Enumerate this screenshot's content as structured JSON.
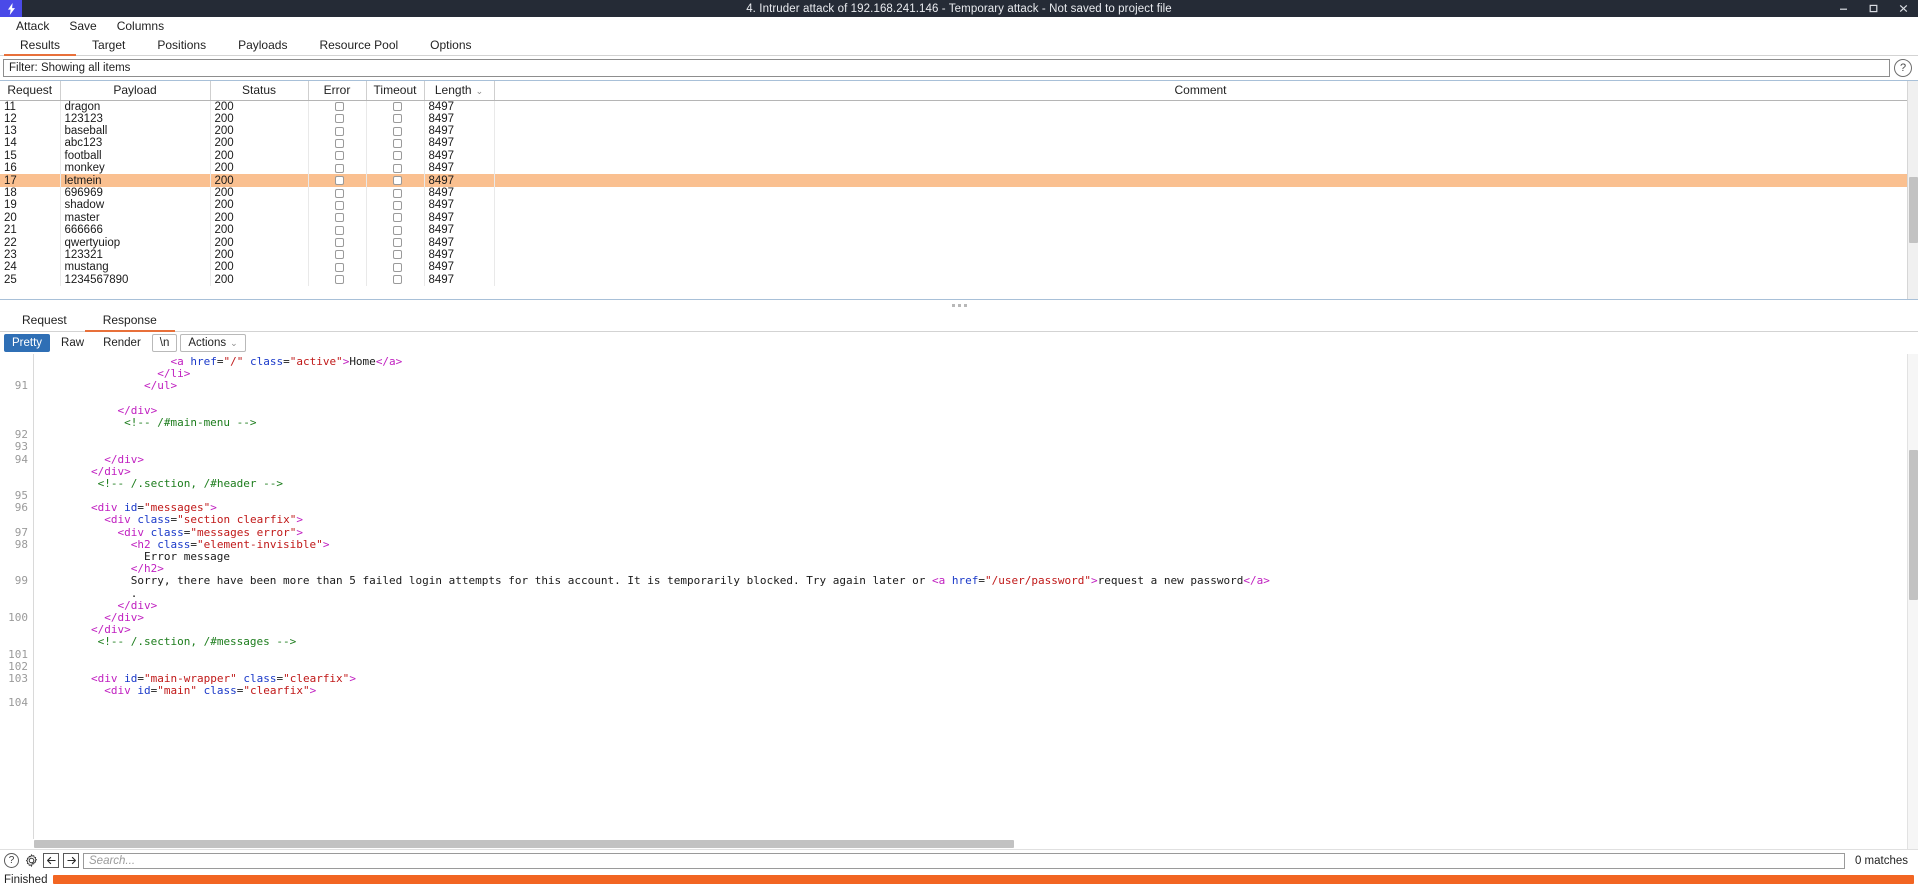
{
  "window": {
    "title": "4. Intruder attack of 192.168.241.146 - Temporary attack - Not saved to project file",
    "logo_icon": "burp-logo-icon",
    "minimize_icon": "minimize-icon",
    "maximize_icon": "maximize-icon",
    "close_icon": "close-icon"
  },
  "menubar": {
    "items": [
      {
        "label": "Attack"
      },
      {
        "label": "Save"
      },
      {
        "label": "Columns"
      }
    ]
  },
  "tabbar": {
    "tabs": [
      {
        "label": "Results",
        "active": true
      },
      {
        "label": "Target",
        "active": false
      },
      {
        "label": "Positions",
        "active": false
      },
      {
        "label": "Payloads",
        "active": false
      },
      {
        "label": "Resource Pool",
        "active": false
      },
      {
        "label": "Options",
        "active": false
      }
    ]
  },
  "filter": {
    "text": "Filter: Showing all items",
    "help_icon": "help-circle-icon"
  },
  "results_table": {
    "columns": [
      {
        "label": "Request"
      },
      {
        "label": "Payload"
      },
      {
        "label": "Status"
      },
      {
        "label": "Error"
      },
      {
        "label": "Timeout"
      },
      {
        "label": "Length",
        "sorted": true,
        "sort_caret": "⌄"
      },
      {
        "label": "Comment"
      }
    ],
    "rows": [
      {
        "request": "11",
        "payload": "dragon",
        "status": "200",
        "error": false,
        "timeout": false,
        "length": "8497",
        "comment": "",
        "highlight": false
      },
      {
        "request": "12",
        "payload": "123123",
        "status": "200",
        "error": false,
        "timeout": false,
        "length": "8497",
        "comment": "",
        "highlight": false
      },
      {
        "request": "13",
        "payload": "baseball",
        "status": "200",
        "error": false,
        "timeout": false,
        "length": "8497",
        "comment": "",
        "highlight": false
      },
      {
        "request": "14",
        "payload": "abc123",
        "status": "200",
        "error": false,
        "timeout": false,
        "length": "8497",
        "comment": "",
        "highlight": false
      },
      {
        "request": "15",
        "payload": "football",
        "status": "200",
        "error": false,
        "timeout": false,
        "length": "8497",
        "comment": "",
        "highlight": false
      },
      {
        "request": "16",
        "payload": "monkey",
        "status": "200",
        "error": false,
        "timeout": false,
        "length": "8497",
        "comment": "",
        "highlight": false
      },
      {
        "request": "17",
        "payload": "letmein",
        "status": "200",
        "error": false,
        "timeout": false,
        "length": "8497",
        "comment": "",
        "highlight": true
      },
      {
        "request": "18",
        "payload": "696969",
        "status": "200",
        "error": false,
        "timeout": false,
        "length": "8497",
        "comment": "",
        "highlight": false
      },
      {
        "request": "19",
        "payload": "shadow",
        "status": "200",
        "error": false,
        "timeout": false,
        "length": "8497",
        "comment": "",
        "highlight": false
      },
      {
        "request": "20",
        "payload": "master",
        "status": "200",
        "error": false,
        "timeout": false,
        "length": "8497",
        "comment": "",
        "highlight": false
      },
      {
        "request": "21",
        "payload": "666666",
        "status": "200",
        "error": false,
        "timeout": false,
        "length": "8497",
        "comment": "",
        "highlight": false
      },
      {
        "request": "22",
        "payload": "qwertyuiop",
        "status": "200",
        "error": false,
        "timeout": false,
        "length": "8497",
        "comment": "",
        "highlight": false
      },
      {
        "request": "23",
        "payload": "123321",
        "status": "200",
        "error": false,
        "timeout": false,
        "length": "8497",
        "comment": "",
        "highlight": false
      },
      {
        "request": "24",
        "payload": "mustang",
        "status": "200",
        "error": false,
        "timeout": false,
        "length": "8497",
        "comment": "",
        "highlight": false
      },
      {
        "request": "25",
        "payload": "1234567890",
        "status": "200",
        "error": false,
        "timeout": false,
        "length": "8497",
        "comment": "",
        "highlight": false
      }
    ]
  },
  "message_tabs": {
    "tabs": [
      {
        "label": "Request",
        "active": false
      },
      {
        "label": "Response",
        "active": true
      }
    ]
  },
  "view_toolbar": {
    "buttons": [
      {
        "label": "Pretty",
        "style": "selected"
      },
      {
        "label": "Raw",
        "style": "plain"
      },
      {
        "label": "Render",
        "style": "plain"
      },
      {
        "label": "\\n",
        "style": "bordered"
      },
      {
        "label": "Actions",
        "style": "bordered",
        "caret": "⌄"
      }
    ]
  },
  "response_code": {
    "lines": [
      {
        "num": "",
        "tokens": [
          {
            "t": "txt",
            "v": "                    "
          },
          {
            "t": "tag",
            "v": "<a "
          },
          {
            "t": "attr",
            "v": "href"
          },
          {
            "t": "txt",
            "v": "="
          },
          {
            "t": "str",
            "v": "\"/\""
          },
          {
            "t": "txt",
            "v": " "
          },
          {
            "t": "attr",
            "v": "class"
          },
          {
            "t": "txt",
            "v": "="
          },
          {
            "t": "str",
            "v": "\"active\""
          },
          {
            "t": "tag",
            "v": ">"
          },
          {
            "t": "txt",
            "v": "Home"
          },
          {
            "t": "tag",
            "v": "</a>"
          }
        ]
      },
      {
        "num": "",
        "tokens": [
          {
            "t": "txt",
            "v": "                  "
          },
          {
            "t": "tag",
            "v": "</li>"
          }
        ]
      },
      {
        "num": "91",
        "tokens": [
          {
            "t": "txt",
            "v": "                "
          },
          {
            "t": "tag",
            "v": "</ul>"
          }
        ]
      },
      {
        "num": "",
        "tokens": [
          {
            "t": "txt",
            "v": ""
          }
        ]
      },
      {
        "num": "",
        "tokens": [
          {
            "t": "txt",
            "v": "            "
          },
          {
            "t": "tag",
            "v": "</div>"
          }
        ]
      },
      {
        "num": "",
        "tokens": [
          {
            "t": "txt",
            "v": "             "
          },
          {
            "t": "cmt",
            "v": "<!-- /#main-menu -->"
          }
        ]
      },
      {
        "num": "92",
        "tokens": [
          {
            "t": "txt",
            "v": ""
          }
        ]
      },
      {
        "num": "93",
        "tokens": [
          {
            "t": "txt",
            "v": ""
          }
        ]
      },
      {
        "num": "94",
        "tokens": [
          {
            "t": "txt",
            "v": "          "
          },
          {
            "t": "tag",
            "v": "</div>"
          }
        ]
      },
      {
        "num": "",
        "tokens": [
          {
            "t": "txt",
            "v": "        "
          },
          {
            "t": "tag",
            "v": "</div>"
          }
        ]
      },
      {
        "num": "",
        "tokens": [
          {
            "t": "txt",
            "v": "         "
          },
          {
            "t": "cmt",
            "v": "<!-- /.section, /#header -->"
          }
        ]
      },
      {
        "num": "95",
        "tokens": [
          {
            "t": "txt",
            "v": ""
          }
        ]
      },
      {
        "num": "96",
        "tokens": [
          {
            "t": "txt",
            "v": "        "
          },
          {
            "t": "tag",
            "v": "<div "
          },
          {
            "t": "attr",
            "v": "id"
          },
          {
            "t": "txt",
            "v": "="
          },
          {
            "t": "str",
            "v": "\"messages\""
          },
          {
            "t": "tag",
            "v": ">"
          }
        ]
      },
      {
        "num": "",
        "tokens": [
          {
            "t": "txt",
            "v": "          "
          },
          {
            "t": "tag",
            "v": "<div "
          },
          {
            "t": "attr",
            "v": "class"
          },
          {
            "t": "txt",
            "v": "="
          },
          {
            "t": "str",
            "v": "\"section clearfix\""
          },
          {
            "t": "tag",
            "v": ">"
          }
        ]
      },
      {
        "num": "97",
        "tokens": [
          {
            "t": "txt",
            "v": "            "
          },
          {
            "t": "tag",
            "v": "<div "
          },
          {
            "t": "attr",
            "v": "class"
          },
          {
            "t": "txt",
            "v": "="
          },
          {
            "t": "str",
            "v": "\"messages error\""
          },
          {
            "t": "tag",
            "v": ">"
          }
        ]
      },
      {
        "num": "98",
        "tokens": [
          {
            "t": "txt",
            "v": "              "
          },
          {
            "t": "tag",
            "v": "<h2 "
          },
          {
            "t": "attr",
            "v": "class"
          },
          {
            "t": "txt",
            "v": "="
          },
          {
            "t": "str",
            "v": "\"element-invisible\""
          },
          {
            "t": "tag",
            "v": ">"
          }
        ]
      },
      {
        "num": "",
        "tokens": [
          {
            "t": "txt",
            "v": "                Error message"
          }
        ]
      },
      {
        "num": "",
        "tokens": [
          {
            "t": "txt",
            "v": "              "
          },
          {
            "t": "tag",
            "v": "</h2>"
          }
        ]
      },
      {
        "num": "99",
        "tokens": [
          {
            "t": "txt",
            "v": "              Sorry, there have been more than 5 failed login attempts for this account. It is temporarily blocked. Try again later or "
          },
          {
            "t": "tag",
            "v": "<a "
          },
          {
            "t": "attr",
            "v": "href"
          },
          {
            "t": "txt",
            "v": "="
          },
          {
            "t": "str",
            "v": "\"/user/password\""
          },
          {
            "t": "tag",
            "v": ">"
          },
          {
            "t": "txt",
            "v": "request a new password"
          },
          {
            "t": "tag",
            "v": "</a>"
          }
        ]
      },
      {
        "num": "",
        "tokens": [
          {
            "t": "txt",
            "v": "              ."
          }
        ]
      },
      {
        "num": "",
        "tokens": [
          {
            "t": "txt",
            "v": "            "
          },
          {
            "t": "tag",
            "v": "</div>"
          }
        ]
      },
      {
        "num": "100",
        "tokens": [
          {
            "t": "txt",
            "v": "          "
          },
          {
            "t": "tag",
            "v": "</div>"
          }
        ]
      },
      {
        "num": "",
        "tokens": [
          {
            "t": "txt",
            "v": "        "
          },
          {
            "t": "tag",
            "v": "</div>"
          }
        ]
      },
      {
        "num": "",
        "tokens": [
          {
            "t": "txt",
            "v": "         "
          },
          {
            "t": "cmt",
            "v": "<!-- /.section, /#messages -->"
          }
        ]
      },
      {
        "num": "101",
        "tokens": [
          {
            "t": "txt",
            "v": ""
          }
        ]
      },
      {
        "num": "102",
        "tokens": [
          {
            "t": "txt",
            "v": ""
          }
        ]
      },
      {
        "num": "103",
        "tokens": [
          {
            "t": "txt",
            "v": "        "
          },
          {
            "t": "tag",
            "v": "<div "
          },
          {
            "t": "attr",
            "v": "id"
          },
          {
            "t": "txt",
            "v": "="
          },
          {
            "t": "str",
            "v": "\"main-wrapper\""
          },
          {
            "t": "txt",
            "v": " "
          },
          {
            "t": "attr",
            "v": "class"
          },
          {
            "t": "txt",
            "v": "="
          },
          {
            "t": "str",
            "v": "\"clearfix\""
          },
          {
            "t": "tag",
            "v": ">"
          }
        ]
      },
      {
        "num": "",
        "tokens": [
          {
            "t": "txt",
            "v": "          "
          },
          {
            "t": "tag",
            "v": "<div "
          },
          {
            "t": "attr",
            "v": "id"
          },
          {
            "t": "txt",
            "v": "="
          },
          {
            "t": "str",
            "v": "\"main\""
          },
          {
            "t": "txt",
            "v": " "
          },
          {
            "t": "attr",
            "v": "class"
          },
          {
            "t": "txt",
            "v": "="
          },
          {
            "t": "str",
            "v": "\"clearfix\""
          },
          {
            "t": "tag",
            "v": ">"
          }
        ]
      },
      {
        "num": "104",
        "tokens": [
          {
            "t": "txt",
            "v": ""
          }
        ]
      }
    ]
  },
  "searchbar": {
    "help_icon": "help-circle-icon",
    "settings_icon": "gear-icon",
    "prev_icon": "arrow-left-icon",
    "next_icon": "arrow-right-icon",
    "placeholder": "Search...",
    "value": "",
    "matches": "0 matches"
  },
  "statusbar": {
    "text": "Finished",
    "progress_percent": 100
  },
  "colors": {
    "accent_orange": "#f26522",
    "tab_underline": "#e8703a",
    "highlight_row": "#fac090",
    "selected_button": "#2f6fb5",
    "titlebar_bg": "#252b36",
    "logo_bg": "#4a4ae8"
  }
}
